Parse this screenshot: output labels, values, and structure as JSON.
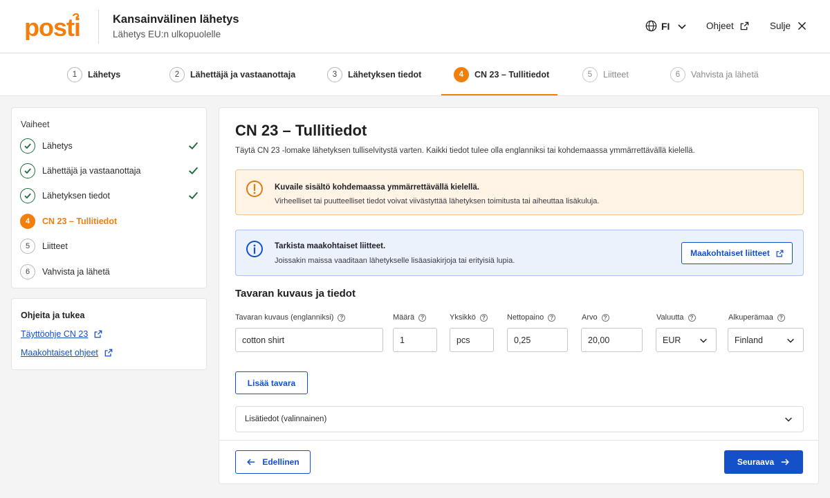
{
  "header": {
    "logo_text": "posti",
    "title": "Kansainvälinen lähetys",
    "subtitle": "Lähetys EU:n ulkopuolelle",
    "language": "FI",
    "help": "Ohjeet",
    "close": "Sulje"
  },
  "stepper": [
    {
      "num": "1",
      "label": "Lähetys",
      "state": "done"
    },
    {
      "num": "2",
      "label": "Lähettäjä ja vastaanottaja",
      "state": "done"
    },
    {
      "num": "3",
      "label": "Lähetyksen tiedot",
      "state": "done"
    },
    {
      "num": "4",
      "label": "CN 23 – Tullitiedot",
      "state": "active"
    },
    {
      "num": "5",
      "label": "Liitteet",
      "state": "future"
    },
    {
      "num": "6",
      "label": "Vahvista ja lähetä",
      "state": "future"
    }
  ],
  "sidebar": {
    "title": "Vaiheet",
    "items": [
      {
        "num": "1",
        "label": "Lähetys",
        "state": "done"
      },
      {
        "num": "2",
        "label": "Lähettäjä ja vastaanottaja",
        "state": "done"
      },
      {
        "num": "3",
        "label": "Lähetyksen tiedot",
        "state": "done"
      },
      {
        "num": "4",
        "label": "CN 23 – Tullitiedot",
        "state": "active"
      },
      {
        "num": "5",
        "label": "Liitteet",
        "state": "todo"
      },
      {
        "num": "6",
        "label": "Vahvista ja lähetä",
        "state": "todo"
      }
    ],
    "help_title": "Ohjeita ja tukea",
    "help_links": [
      "Täyttöohje CN 23",
      "Maakohtaiset ohjeet"
    ]
  },
  "main": {
    "title": "CN 23 – Tullitiedot",
    "description": "Täytä CN 23 -lomake lähetyksen tulliselvitystä varten. Kaikki tiedot tulee olla englanniksi tai kohdemaassa ymmärrettävällä kielellä.",
    "warning": {
      "title": "Kuvaile sisältö kohdemaassa ymmärrettävällä kielellä.",
      "text": "Virheelliset tai puutteelliset tiedot voivat viivästyttää lähetyksen toimitusta tai aiheuttaa lisäkuluja."
    },
    "info": {
      "title": "Tarkista maakohtaiset liitteet.",
      "text": "Joissakin maissa vaaditaan lähetykselle lisäasiakirjoja tai erityisiä lupia.",
      "button": "Maakohtaiset liitteet"
    },
    "section_title": "Tavaran kuvaus ja tiedot",
    "fields": {
      "description": {
        "label": "Tavaran kuvaus (englanniksi)",
        "value": "cotton shirt"
      },
      "quantity": {
        "label": "Määrä",
        "value": "1"
      },
      "unit": {
        "label": "Yksikkö",
        "value": "pcs"
      },
      "net_weight": {
        "label": "Nettopaino",
        "value": "0,25"
      },
      "value": {
        "label": "Arvo",
        "value": "20,00"
      },
      "currency": {
        "label": "Valuutta",
        "value": "EUR"
      },
      "origin": {
        "label": "Alkuperämaa",
        "value": "Finland"
      }
    },
    "add_item": "Lisää tavara",
    "accordion": "Lisätiedot (valinnainen)",
    "prev": "Edellinen",
    "next": "Seuraava"
  },
  "colors": {
    "brand_orange": "#f27f0c",
    "primary_blue": "#1450c8",
    "success_green": "#1c6b39"
  }
}
